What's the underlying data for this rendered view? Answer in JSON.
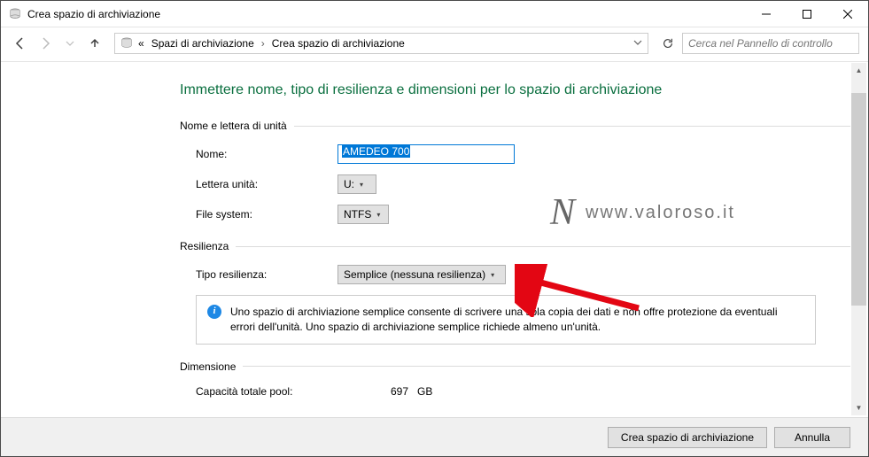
{
  "window": {
    "title": "Crea spazio di archiviazione"
  },
  "breadcrumb": {
    "prefix": "«",
    "items": [
      "Spazi di archiviazione",
      "Crea spazio di archiviazione"
    ]
  },
  "search": {
    "placeholder": "Cerca nel Pannello di controllo"
  },
  "page": {
    "heading": "Immettere nome, tipo di resilienza e dimensioni per lo spazio di archiviazione"
  },
  "group_name": {
    "title": "Nome e lettera di unità",
    "name_label": "Nome:",
    "name_value": "AMEDEO 700",
    "letter_label": "Lettera unità:",
    "letter_value": "U:",
    "fs_label": "File system:",
    "fs_value": "NTFS"
  },
  "group_res": {
    "title": "Resilienza",
    "type_label": "Tipo resilienza:",
    "type_value": "Semplice (nessuna resilienza)",
    "info": "Uno spazio di archiviazione semplice consente di scrivere una sola copia dei dati e non offre protezione da eventuali errori dell'unità. Uno spazio di archiviazione semplice richiede almeno un'unità."
  },
  "group_dim": {
    "title": "Dimensione",
    "capacity_label": "Capacità totale pool:",
    "capacity_value": "697",
    "capacity_unit": "GB"
  },
  "buttons": {
    "create": "Crea spazio di archiviazione",
    "cancel": "Annulla"
  },
  "watermark": {
    "logo": "N",
    "url": "www.valoroso.it"
  }
}
